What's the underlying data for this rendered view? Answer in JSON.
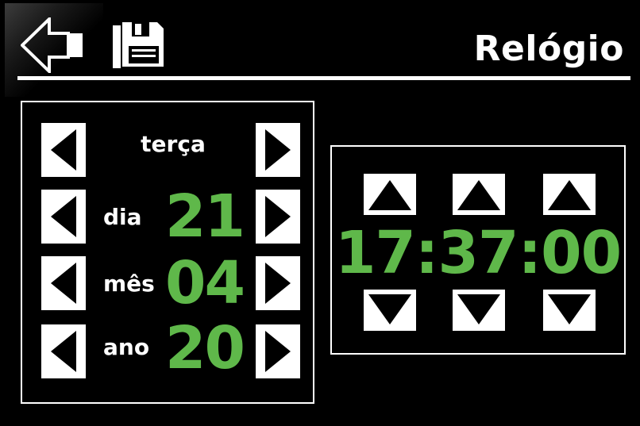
{
  "header": {
    "title": "Relógio"
  },
  "date": {
    "weekday": "terça",
    "rows": [
      {
        "label": "dia",
        "value": "21"
      },
      {
        "label": "mês",
        "value": "04"
      },
      {
        "label": "ano",
        "value": "20"
      }
    ]
  },
  "time": {
    "display": "17:37:00"
  },
  "colors": {
    "accent": "#5fb84a",
    "background": "#000000",
    "foreground": "#ffffff"
  },
  "icons": {
    "back": "back-arrow-icon",
    "save": "floppy-disk-icon",
    "left": "triangle-left-icon",
    "right": "triangle-right-icon",
    "up": "triangle-up-icon",
    "down": "triangle-down-icon"
  }
}
